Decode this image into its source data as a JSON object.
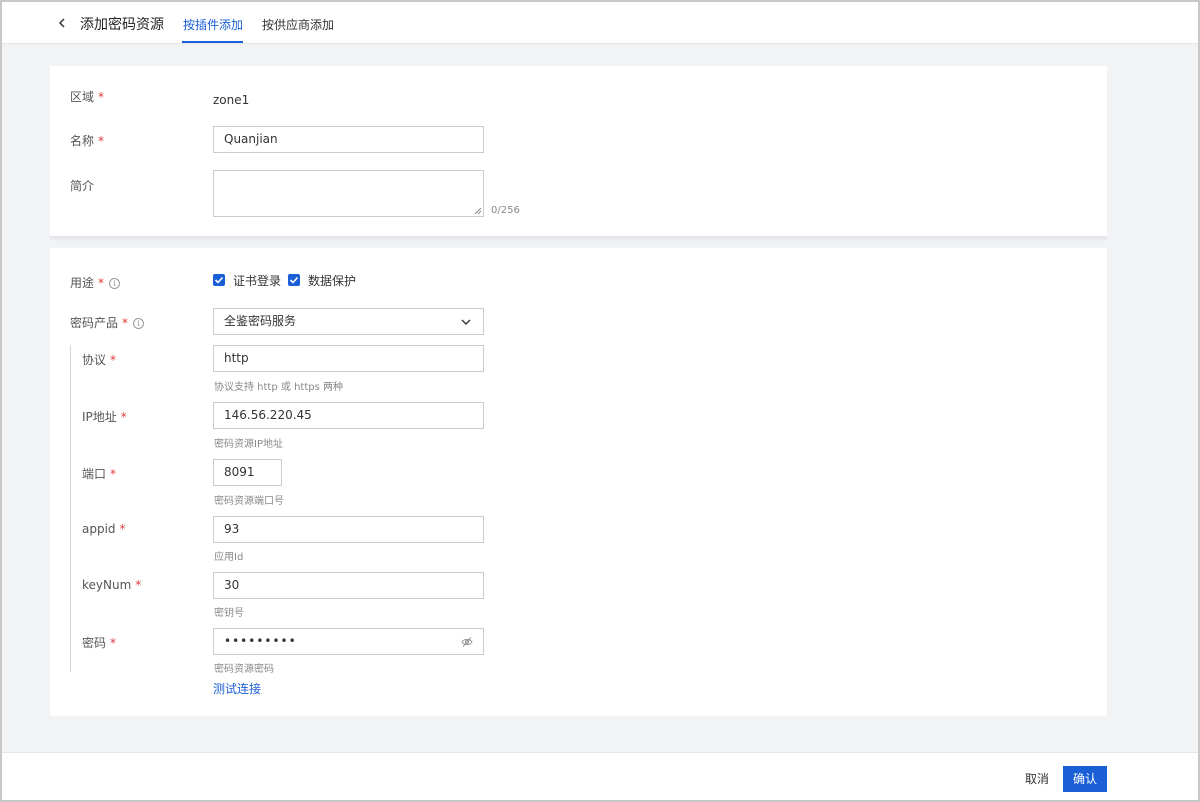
{
  "header": {
    "title": "添加密码资源",
    "tabs": [
      {
        "label": "按插件添加",
        "active": true
      },
      {
        "label": "按供应商添加",
        "active": false
      }
    ]
  },
  "basic": {
    "region_label": "区域",
    "region_value": "zone1",
    "name_label": "名称",
    "name_value": "Quanjian",
    "desc_label": "简介",
    "desc_value": "",
    "desc_counter": "0/256"
  },
  "config": {
    "usage_label": "用途",
    "usage_options": [
      {
        "label": "证书登录",
        "checked": true
      },
      {
        "label": "数据保护",
        "checked": true
      }
    ],
    "product_label": "密码产品",
    "product_value": "全鉴密码服务",
    "protocol_label": "协议",
    "protocol_value": "http",
    "protocol_hint": "协议支持 http 或 https 两种",
    "ip_label": "IP地址",
    "ip_value": "146.56.220.45",
    "ip_hint": "密码资源IP地址",
    "port_label": "端口",
    "port_value": "8091",
    "port_hint": "密码资源端口号",
    "appid_label": "appid",
    "appid_value": "93",
    "appid_hint": "应用Id",
    "keynum_label": "keyNum",
    "keynum_value": "30",
    "keynum_hint": "密钥号",
    "password_label": "密码",
    "password_value": "•••••••••",
    "password_hint": "密码资源密码",
    "test_link": "测试连接"
  },
  "footer": {
    "cancel": "取消",
    "confirm": "确认"
  },
  "colors": {
    "accent": "#1a5fd6",
    "required": "#e03c3c"
  },
  "required_mark": "*",
  "info_mark": "i"
}
